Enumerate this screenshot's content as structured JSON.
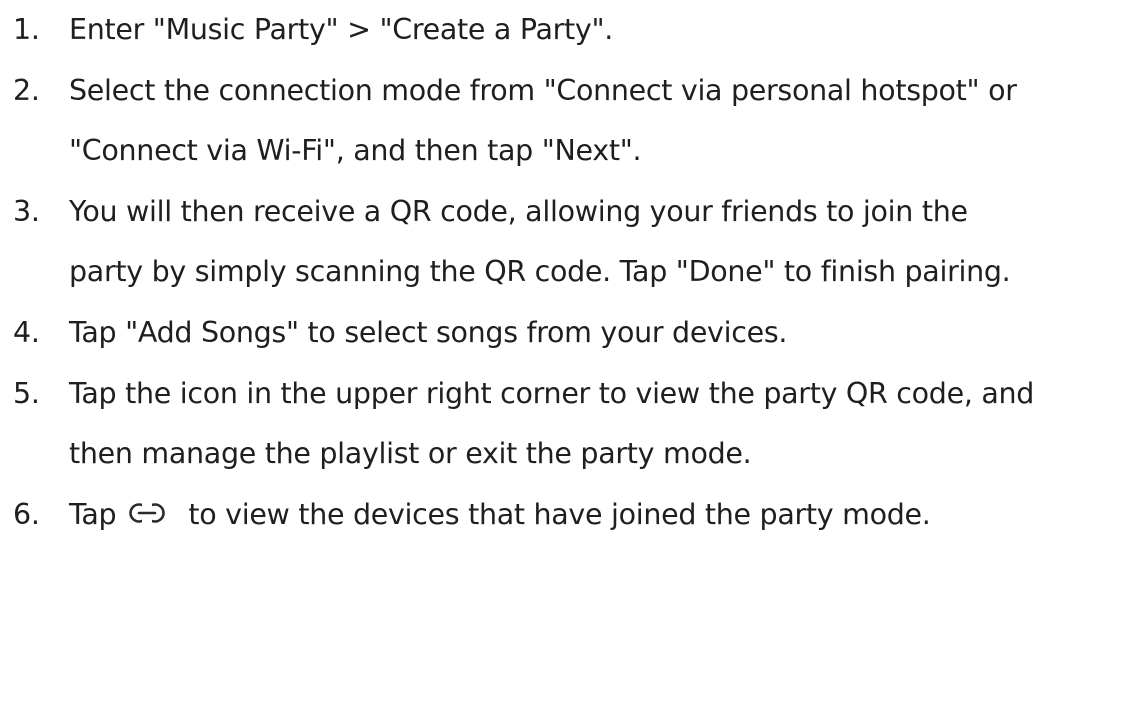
{
  "steps": [
    {
      "number": "1.",
      "lines": [
        "Enter \"Music Party\" > \"Create a Party\"."
      ]
    },
    {
      "number": "2.",
      "lines": [
        "Select the connection mode from \"Connect via personal hotspot\" or",
        "\"Connect via Wi-Fi\", and then tap \"Next\"."
      ]
    },
    {
      "number": "3.",
      "lines": [
        "You will then receive a QR code, allowing your friends to join the",
        "party by simply scanning the QR code. Tap \"Done\" to finish pairing."
      ]
    },
    {
      "number": "4.",
      "lines": [
        "Tap \"Add Songs\" to select songs from your devices."
      ]
    },
    {
      "number": "5.",
      "lines": [
        "Tap the icon in the upper right corner to view the party QR code, and",
        "then manage the playlist or exit the party mode."
      ]
    },
    {
      "number": "6.",
      "before_icon": "Tap",
      "icon": "link-icon",
      "after_icon": "to view the devices that have joined the party mode."
    }
  ],
  "colors": {
    "text": "#1f1f1f",
    "icon": "#2b2b2b"
  }
}
